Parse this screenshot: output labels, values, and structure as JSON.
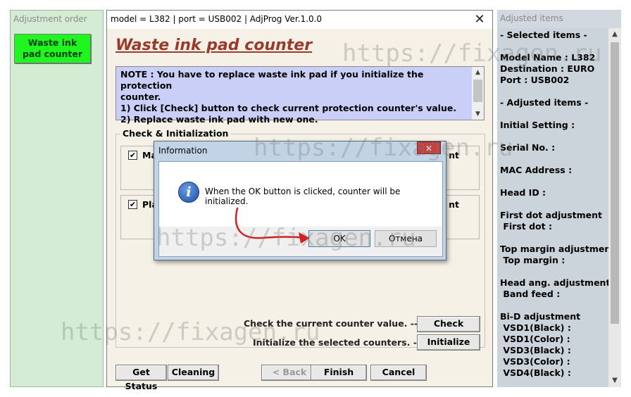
{
  "left_panel": {
    "title": "Adjustment order",
    "item_label": "Waste ink pad counter"
  },
  "main_window": {
    "title": "model = L382 | port = USB002 | AdjProg Ver.1.0.0",
    "close_glyph": "✕",
    "heading": "Waste ink pad counter",
    "note": {
      "line1": "NOTE : You have to replace waste ink pad if you initialize the protection",
      "line2": "counter.",
      "line3": "1) Click [Check] button to check current protection counter's value.",
      "line4": "2) Replace waste ink pad with new one."
    },
    "group_title": "Check & Initialization",
    "rows": [
      {
        "label": "Ma",
        "tail": "nt",
        "checked": true
      },
      {
        "label": "Pla",
        "tail": "nt",
        "checked": true
      }
    ],
    "check_prompt": "Check the current counter value. -->",
    "check_button": "Check",
    "init_prompt": "Initialize the selected counters. -->",
    "init_button": "Initialize",
    "footer": {
      "get_status": "Get Status",
      "cleaning": "Cleaning",
      "back": "< Back",
      "finish": "Finish",
      "cancel": "Cancel"
    }
  },
  "dialog": {
    "title": "Information",
    "close_glyph": "✕",
    "message": "When the OK button is clicked, counter will be initialized.",
    "ok": "OK",
    "cancel": "Отмена",
    "icon": "info-icon"
  },
  "right_panel": {
    "title": "Adjusted items",
    "items": [
      "- Selected items -",
      "",
      "Model Name : L382",
      "Destination : EURO",
      "Port : USB002",
      "",
      "- Adjusted items -",
      "",
      "Initial Setting :",
      "",
      "Serial No. :",
      "",
      "MAC Address :",
      "",
      "Head ID :",
      "",
      "First dot adjustment",
      " First dot :",
      "",
      "Top margin adjustment",
      " Top margin :",
      "",
      "Head ang. adjustment",
      " Band feed :",
      "",
      "Bi-D adjustment",
      " VSD1(Black) :",
      " VSD1(Color) :",
      " VSD3(Black) :",
      " VSD3(Color) :",
      " VSD4(Black) :"
    ]
  },
  "watermark": "https://fixagen.ru",
  "colors": {
    "left_button": "#1ff51f",
    "note_bg": "#c9cff7",
    "heading": "#9a3a2a",
    "arrow": "#d42020"
  }
}
